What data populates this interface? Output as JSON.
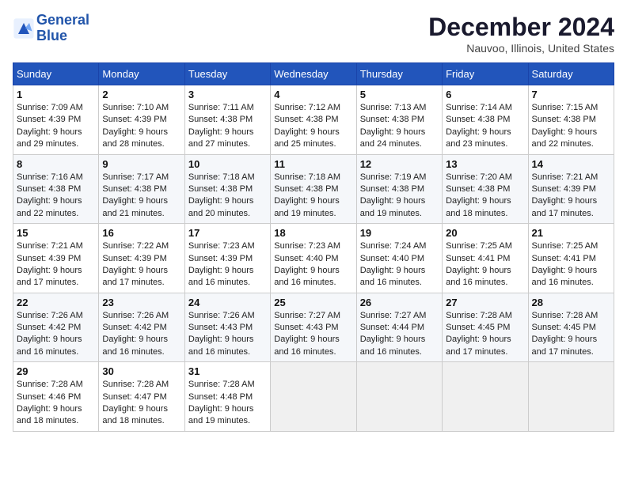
{
  "header": {
    "logo_line1": "General",
    "logo_line2": "Blue",
    "title": "December 2024",
    "location": "Nauvoo, Illinois, United States"
  },
  "weekdays": [
    "Sunday",
    "Monday",
    "Tuesday",
    "Wednesday",
    "Thursday",
    "Friday",
    "Saturday"
  ],
  "weeks": [
    [
      {
        "day": "1",
        "sunrise": "7:09 AM",
        "sunset": "4:39 PM",
        "daylight": "9 hours and 29 minutes."
      },
      {
        "day": "2",
        "sunrise": "7:10 AM",
        "sunset": "4:39 PM",
        "daylight": "9 hours and 28 minutes."
      },
      {
        "day": "3",
        "sunrise": "7:11 AM",
        "sunset": "4:38 PM",
        "daylight": "9 hours and 27 minutes."
      },
      {
        "day": "4",
        "sunrise": "7:12 AM",
        "sunset": "4:38 PM",
        "daylight": "9 hours and 25 minutes."
      },
      {
        "day": "5",
        "sunrise": "7:13 AM",
        "sunset": "4:38 PM",
        "daylight": "9 hours and 24 minutes."
      },
      {
        "day": "6",
        "sunrise": "7:14 AM",
        "sunset": "4:38 PM",
        "daylight": "9 hours and 23 minutes."
      },
      {
        "day": "7",
        "sunrise": "7:15 AM",
        "sunset": "4:38 PM",
        "daylight": "9 hours and 22 minutes."
      }
    ],
    [
      {
        "day": "8",
        "sunrise": "7:16 AM",
        "sunset": "4:38 PM",
        "daylight": "9 hours and 22 minutes."
      },
      {
        "day": "9",
        "sunrise": "7:17 AM",
        "sunset": "4:38 PM",
        "daylight": "9 hours and 21 minutes."
      },
      {
        "day": "10",
        "sunrise": "7:18 AM",
        "sunset": "4:38 PM",
        "daylight": "9 hours and 20 minutes."
      },
      {
        "day": "11",
        "sunrise": "7:18 AM",
        "sunset": "4:38 PM",
        "daylight": "9 hours and 19 minutes."
      },
      {
        "day": "12",
        "sunrise": "7:19 AM",
        "sunset": "4:38 PM",
        "daylight": "9 hours and 19 minutes."
      },
      {
        "day": "13",
        "sunrise": "7:20 AM",
        "sunset": "4:38 PM",
        "daylight": "9 hours and 18 minutes."
      },
      {
        "day": "14",
        "sunrise": "7:21 AM",
        "sunset": "4:39 PM",
        "daylight": "9 hours and 17 minutes."
      }
    ],
    [
      {
        "day": "15",
        "sunrise": "7:21 AM",
        "sunset": "4:39 PM",
        "daylight": "9 hours and 17 minutes."
      },
      {
        "day": "16",
        "sunrise": "7:22 AM",
        "sunset": "4:39 PM",
        "daylight": "9 hours and 17 minutes."
      },
      {
        "day": "17",
        "sunrise": "7:23 AM",
        "sunset": "4:39 PM",
        "daylight": "9 hours and 16 minutes."
      },
      {
        "day": "18",
        "sunrise": "7:23 AM",
        "sunset": "4:40 PM",
        "daylight": "9 hours and 16 minutes."
      },
      {
        "day": "19",
        "sunrise": "7:24 AM",
        "sunset": "4:40 PM",
        "daylight": "9 hours and 16 minutes."
      },
      {
        "day": "20",
        "sunrise": "7:25 AM",
        "sunset": "4:41 PM",
        "daylight": "9 hours and 16 minutes."
      },
      {
        "day": "21",
        "sunrise": "7:25 AM",
        "sunset": "4:41 PM",
        "daylight": "9 hours and 16 minutes."
      }
    ],
    [
      {
        "day": "22",
        "sunrise": "7:26 AM",
        "sunset": "4:42 PM",
        "daylight": "9 hours and 16 minutes."
      },
      {
        "day": "23",
        "sunrise": "7:26 AM",
        "sunset": "4:42 PM",
        "daylight": "9 hours and 16 minutes."
      },
      {
        "day": "24",
        "sunrise": "7:26 AM",
        "sunset": "4:43 PM",
        "daylight": "9 hours and 16 minutes."
      },
      {
        "day": "25",
        "sunrise": "7:27 AM",
        "sunset": "4:43 PM",
        "daylight": "9 hours and 16 minutes."
      },
      {
        "day": "26",
        "sunrise": "7:27 AM",
        "sunset": "4:44 PM",
        "daylight": "9 hours and 16 minutes."
      },
      {
        "day": "27",
        "sunrise": "7:28 AM",
        "sunset": "4:45 PM",
        "daylight": "9 hours and 17 minutes."
      },
      {
        "day": "28",
        "sunrise": "7:28 AM",
        "sunset": "4:45 PM",
        "daylight": "9 hours and 17 minutes."
      }
    ],
    [
      {
        "day": "29",
        "sunrise": "7:28 AM",
        "sunset": "4:46 PM",
        "daylight": "9 hours and 18 minutes."
      },
      {
        "day": "30",
        "sunrise": "7:28 AM",
        "sunset": "4:47 PM",
        "daylight": "9 hours and 18 minutes."
      },
      {
        "day": "31",
        "sunrise": "7:28 AM",
        "sunset": "4:48 PM",
        "daylight": "9 hours and 19 minutes."
      },
      null,
      null,
      null,
      null
    ]
  ]
}
